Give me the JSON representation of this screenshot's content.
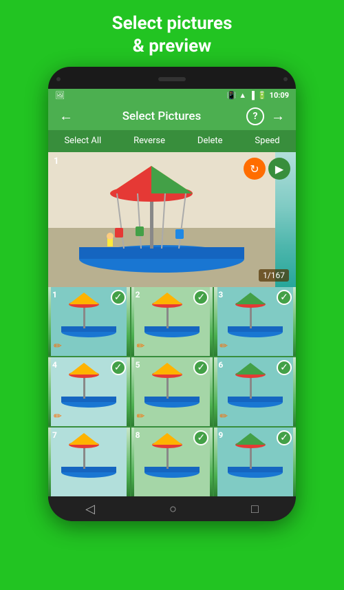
{
  "page": {
    "background_color": "#22c422",
    "title_line1": "Select pictures",
    "title_line2": "& preview"
  },
  "status_bar": {
    "left_icon": "photo-icon",
    "right_items": [
      "vibrate-icon",
      "wifi-icon",
      "signal-icon",
      "battery-icon"
    ],
    "time": "10:09"
  },
  "toolbar": {
    "back_label": "←",
    "title": "Select Pictures",
    "help_label": "?",
    "forward_label": "→"
  },
  "action_bar": {
    "buttons": [
      "Select All",
      "Reverse",
      "Delete",
      "Speed"
    ]
  },
  "preview": {
    "number": "1",
    "counter": "1/167"
  },
  "grid": {
    "items": [
      {
        "num": "1",
        "checked": true
      },
      {
        "num": "2",
        "checked": true
      },
      {
        "num": "3",
        "checked": true
      },
      {
        "num": "4",
        "checked": true
      },
      {
        "num": "5",
        "checked": true
      },
      {
        "num": "6",
        "checked": true
      },
      {
        "num": "7",
        "checked": false
      },
      {
        "num": "8",
        "checked": true
      },
      {
        "num": "9",
        "checked": false
      }
    ]
  },
  "nav_bar": {
    "back_icon": "back-nav-icon",
    "home_icon": "home-nav-icon",
    "recent_icon": "recent-nav-icon"
  }
}
